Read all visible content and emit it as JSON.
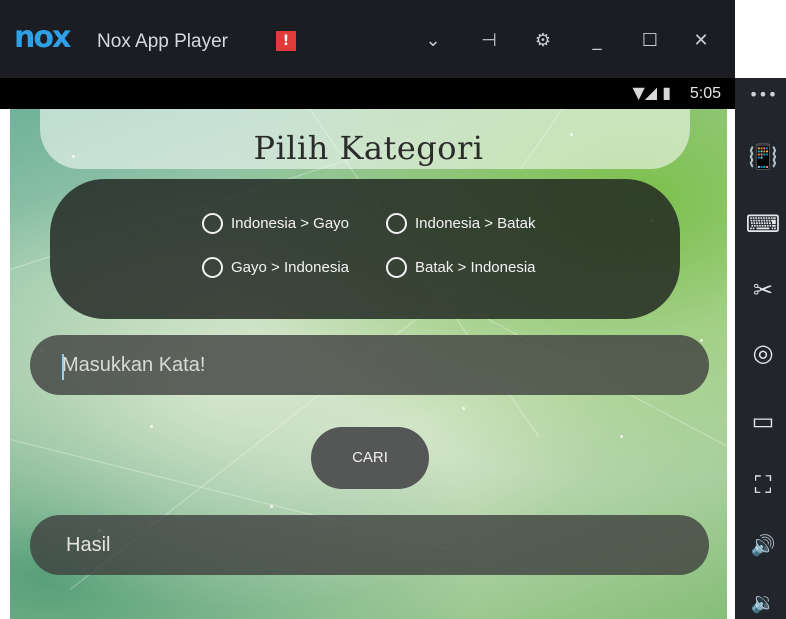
{
  "window": {
    "logo_text": "nox",
    "title": "Nox App Player",
    "alert_glyph": "!",
    "controls": [
      {
        "name": "chevron-down-icon",
        "glyph": "⌄"
      },
      {
        "name": "pin-icon",
        "glyph": "⊣"
      },
      {
        "name": "settings-gear-icon",
        "glyph": "⚙"
      },
      {
        "name": "minimize-icon",
        "glyph": "_"
      },
      {
        "name": "maximize-icon",
        "glyph": "☐"
      },
      {
        "name": "close-icon",
        "glyph": "✕"
      }
    ],
    "more_glyph": "•••"
  },
  "sidebar": {
    "icons": [
      {
        "name": "shake-phone-icon",
        "glyph": "📳"
      },
      {
        "name": "keyboard-icon",
        "glyph": "⌨"
      },
      {
        "name": "screenshot-scissors-icon",
        "glyph": "✂"
      },
      {
        "name": "location-icon",
        "glyph": "◎"
      },
      {
        "name": "screen-icon",
        "glyph": "▭"
      },
      {
        "name": "fullscreen-icon",
        "glyph": "⛶"
      },
      {
        "name": "volume-up-icon",
        "glyph": "🔊"
      },
      {
        "name": "volume-down-icon",
        "glyph": "🔉"
      }
    ]
  },
  "status_bar": {
    "icons": "▼◢ ▮",
    "time": "5:05"
  },
  "app": {
    "title": "Pilih Kategori",
    "options": [
      "Indonesia > Gayo",
      "Indonesia > Batak",
      "Gayo > Indonesia",
      "Batak > Indonesia"
    ],
    "search_placeholder": "Masukkan Kata!",
    "search_button": "CARI",
    "result_text": "Hasil"
  },
  "colors": {
    "nox_blue": "#2f9fe6",
    "alert_red": "#e03a3a",
    "titlebar_bg": "#1b1d22",
    "panel_dark": "#1e2320"
  }
}
